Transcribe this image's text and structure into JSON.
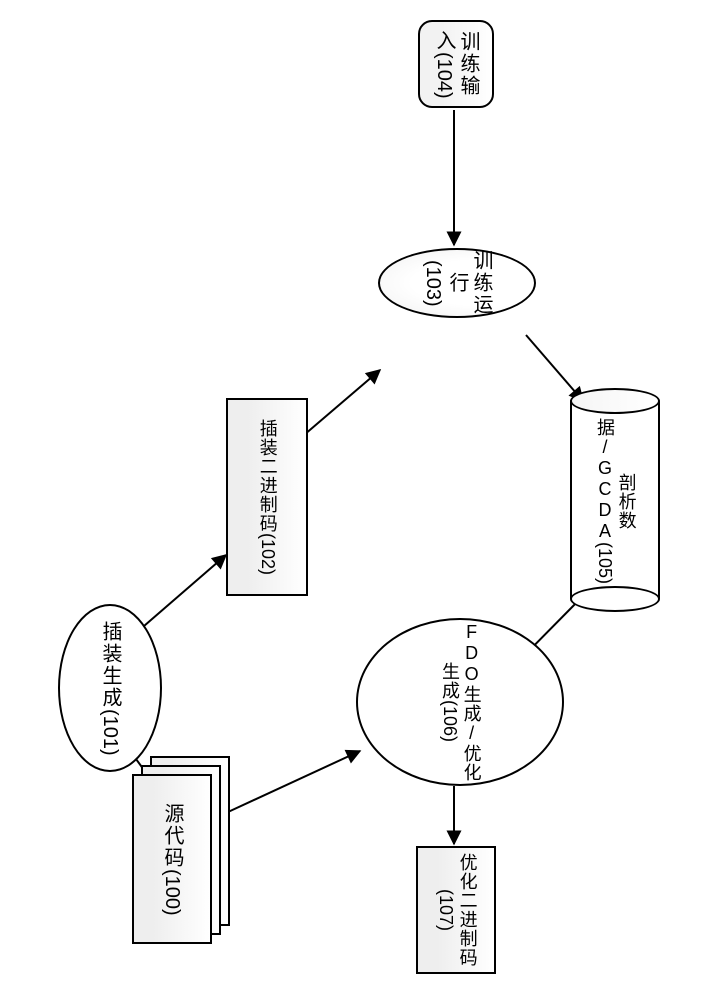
{
  "nodes": {
    "sourceCode": {
      "label": "源代码",
      "id": "(100)"
    },
    "instrGen": {
      "label": "插装生成",
      "id": "(101)"
    },
    "instrBinary": {
      "label": "插装二进制码",
      "id": "(102)"
    },
    "trainRun": {
      "label": "训练运行",
      "id": "(103)"
    },
    "trainInput": {
      "label": "训练输入",
      "id": "(104)"
    },
    "profileData": {
      "label": "剖析数据/GCDA",
      "id": "(105)"
    },
    "fdoGen": {
      "label": "FDO生成/优化生成",
      "id": "(106)"
    },
    "optBinary": {
      "label": "优化二进制码",
      "id": "(107)"
    }
  },
  "chart_data": {
    "type": "diagram",
    "title": "",
    "node_defs": [
      {
        "key": "sourceCode",
        "id": 100,
        "label": "源代码",
        "shape": "stacked-document"
      },
      {
        "key": "instrGen",
        "id": 101,
        "label": "插装生成",
        "shape": "ellipse"
      },
      {
        "key": "instrBinary",
        "id": 102,
        "label": "插装二进制码",
        "shape": "rectangle"
      },
      {
        "key": "trainRun",
        "id": 103,
        "label": "训练运行",
        "shape": "ellipse"
      },
      {
        "key": "trainInput",
        "id": 104,
        "label": "训练输入",
        "shape": "rounded-rectangle"
      },
      {
        "key": "profileData",
        "id": 105,
        "label": "剖析数据/GCDA",
        "shape": "cylinder"
      },
      {
        "key": "fdoGen",
        "id": 106,
        "label": "FDO生成/优化生成",
        "shape": "ellipse"
      },
      {
        "key": "optBinary",
        "id": 107,
        "label": "优化二进制码",
        "shape": "rectangle"
      }
    ],
    "edges": [
      {
        "from": "sourceCode",
        "to": "instrGen"
      },
      {
        "from": "instrGen",
        "to": "instrBinary"
      },
      {
        "from": "instrBinary",
        "to": "trainRun"
      },
      {
        "from": "trainInput",
        "to": "trainRun"
      },
      {
        "from": "trainRun",
        "to": "profileData"
      },
      {
        "from": "profileData",
        "to": "fdoGen"
      },
      {
        "from": "sourceCode",
        "to": "fdoGen"
      },
      {
        "from": "fdoGen",
        "to": "optBinary"
      }
    ]
  }
}
